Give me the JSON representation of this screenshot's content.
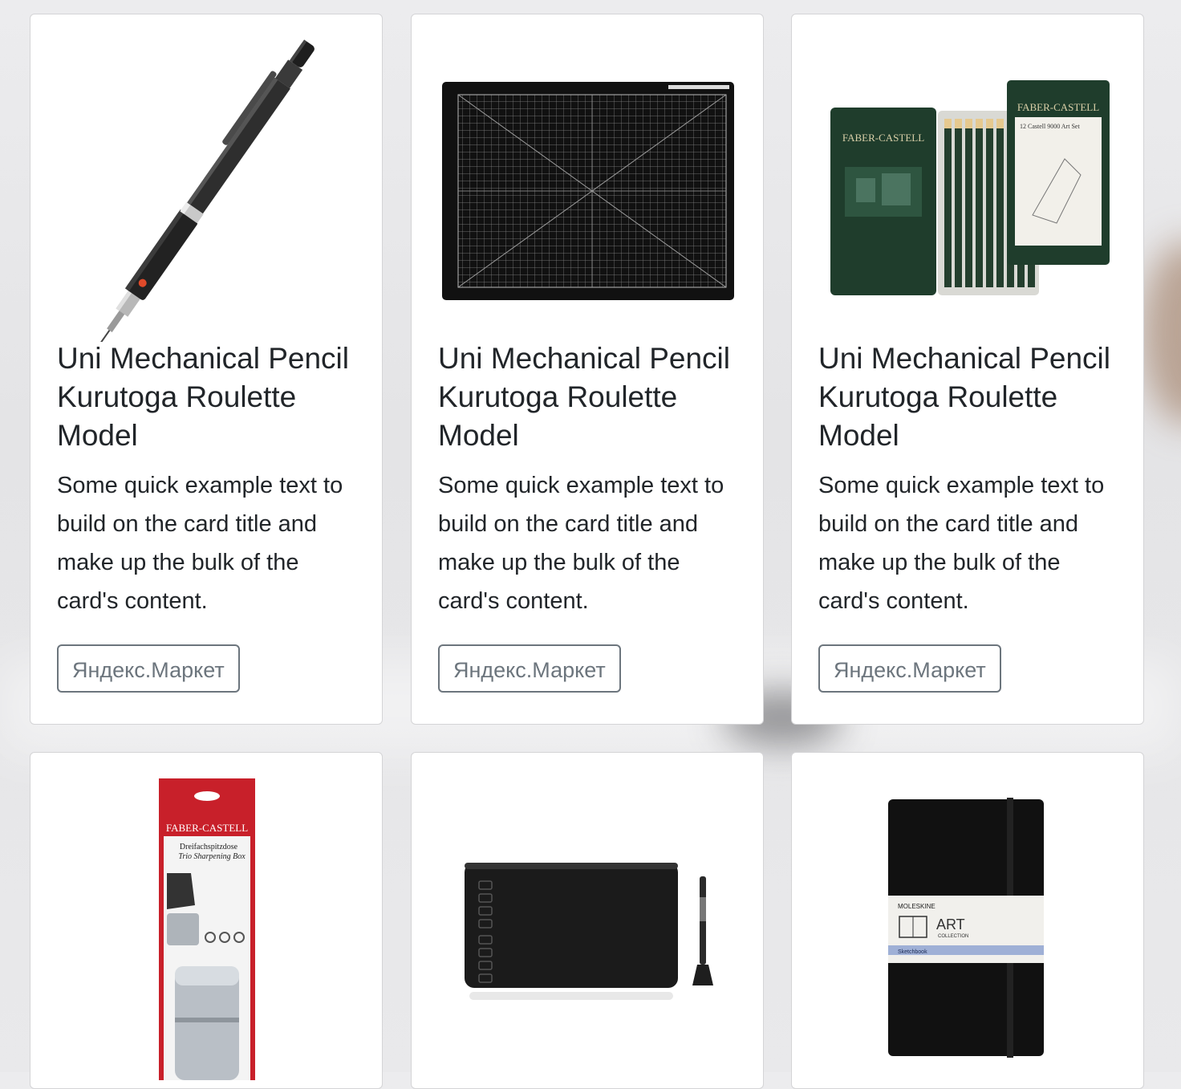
{
  "cards": [
    {
      "image_name": "mechanical-pencil-image",
      "title": "Uni Mechanical Pencil Kurutoga Roulette Model",
      "text": "Some quick example text to build on the card title and make up the bulk of the card's content.",
      "button_label": "Яндекс.Маркет"
    },
    {
      "image_name": "cutting-mat-image",
      "title": "Uni Mechanical Pencil Kurutoga Roulette Model",
      "text": "Some quick example text to build on the card title and make up the bulk of the card's content.",
      "button_label": "Яндекс.Маркет"
    },
    {
      "image_name": "faber-castell-pencil-set-image",
      "title": "Uni Mechanical Pencil Kurutoga Roulette Model",
      "text": "Some quick example text to build on the card title and make up the bulk of the card's content.",
      "button_label": "Яндекс.Маркет",
      "brand": "FABER-CASTELL",
      "set_label": "12 Castell 9000 Art Set"
    },
    {
      "image_name": "faber-castell-sharpener-image",
      "brand": "FABER-CASTELL",
      "product_de": "Dreifachspitzdose",
      "product_en": "Trio Sharpening Box"
    },
    {
      "image_name": "graphics-tablet-image"
    },
    {
      "image_name": "moleskine-sketchbook-image",
      "brand": "MOLESKINE",
      "line": "ART",
      "collection": "COLLECTION",
      "label": "Sketchbook"
    }
  ],
  "colors": {
    "card_border": "#d4d4d6",
    "button_border": "#6c757d",
    "text": "#212529",
    "fc_green": "#1f3d2c",
    "fc_red": "#c8202a"
  }
}
